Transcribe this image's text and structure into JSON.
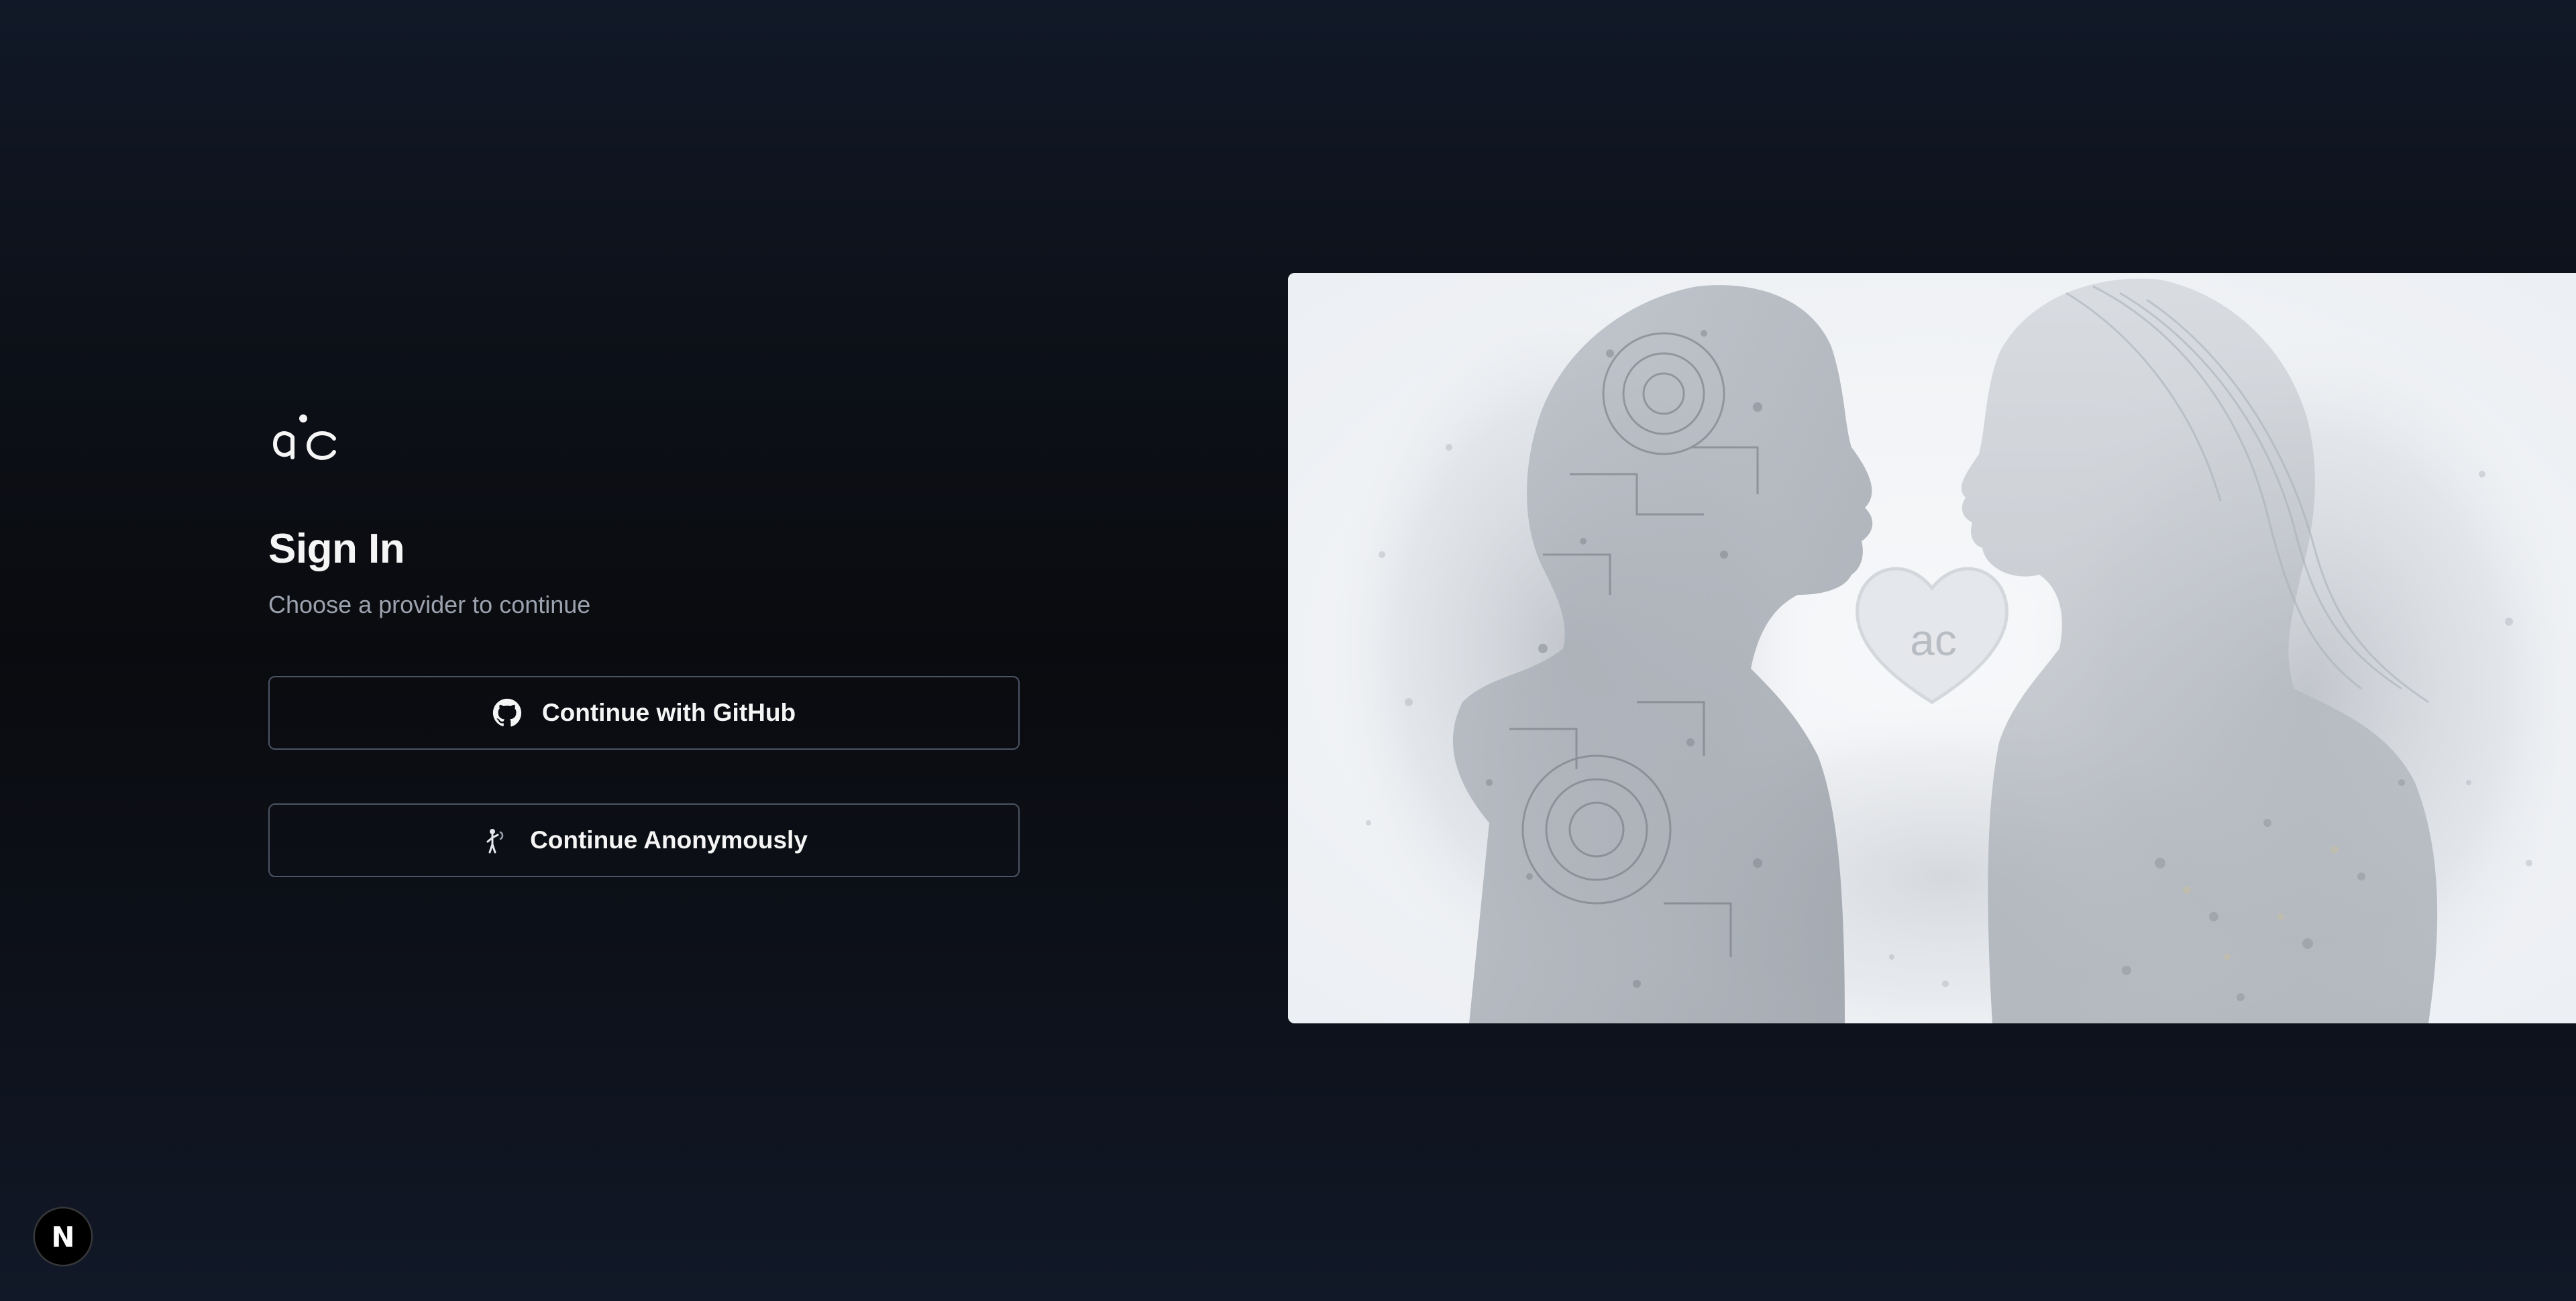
{
  "signin": {
    "logo_icon": "ac-logo-icon",
    "title": "Sign In",
    "subtitle": "Choose a provider to continue",
    "providers": [
      {
        "label": "Continue with GitHub",
        "icon": "github-icon"
      },
      {
        "label": "Continue Anonymously",
        "icon": "anonymous-figure-icon"
      }
    ]
  },
  "hero": {
    "description_icon": "robot-and-woman-illustration",
    "watermark_text": "ac"
  },
  "badge": {
    "text": "N",
    "icon": "nextjs-dev-indicator-icon"
  },
  "colors": {
    "background": "#0f131c",
    "text_primary": "#f5f5f5",
    "text_secondary": "#9ca3af",
    "button_border": "#4b5563",
    "hero_background": "#f1f3f6"
  }
}
